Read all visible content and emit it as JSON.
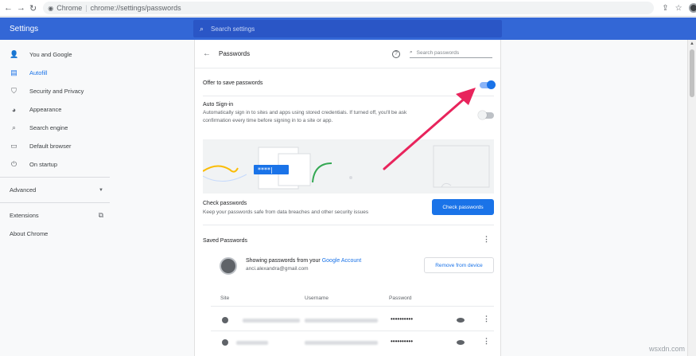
{
  "browser": {
    "back": "←",
    "forward": "→",
    "reload": "↻",
    "site_label": "Chrome",
    "url": "chrome://settings/passwords"
  },
  "header": {
    "title": "Settings",
    "search_placeholder": "Search settings"
  },
  "sidebar": {
    "items": [
      {
        "label": "You and Google",
        "icon": "person-icon",
        "glyph": "👤"
      },
      {
        "label": "Autofill",
        "icon": "autofill-icon",
        "glyph": "▤",
        "active": true
      },
      {
        "label": "Security and Privacy",
        "icon": "shield-icon",
        "glyph": "⛉"
      },
      {
        "label": "Appearance",
        "icon": "palette-icon",
        "glyph": "◕"
      },
      {
        "label": "Search engine",
        "icon": "search-icon",
        "glyph": "⌕"
      },
      {
        "label": "Default browser",
        "icon": "browser-icon",
        "glyph": "▭"
      },
      {
        "label": "On startup",
        "icon": "power-icon",
        "glyph": "⏻"
      }
    ],
    "advanced": "Advanced",
    "extensions": "Extensions",
    "about": "About Chrome"
  },
  "passwords": {
    "title": "Passwords",
    "search_placeholder": "Search passwords",
    "offer_to_save": "Offer to save passwords",
    "offer_to_save_on": true,
    "auto_signin": "Auto Sign-in",
    "auto_signin_desc_1": "Automatically sign in to sites and apps using stored credentials. If turned off, you'll be ask",
    "auto_signin_desc_2": "confirmation every time before signing in to a site or app.",
    "auto_signin_on": false,
    "check_title": "Check passwords",
    "check_desc": "Keep your passwords safe from data breaches and other security issues",
    "check_button": "Check passwords",
    "saved_title": "Saved Passwords",
    "showing_from": "Showing passwords from your",
    "google_account": "Google Account",
    "account_email": "anci.alexandra@gmail.com",
    "remove_button": "Remove from device",
    "columns": {
      "site": "Site",
      "username": "Username",
      "password": "Password"
    },
    "rows": [
      {
        "password": "••••••••••"
      },
      {
        "password": "••••••••••"
      }
    ]
  },
  "watermark": "wsxdn.com",
  "colors": {
    "accent": "#1a73e8",
    "header": "#3367d6",
    "arrow": "#e8245c"
  }
}
